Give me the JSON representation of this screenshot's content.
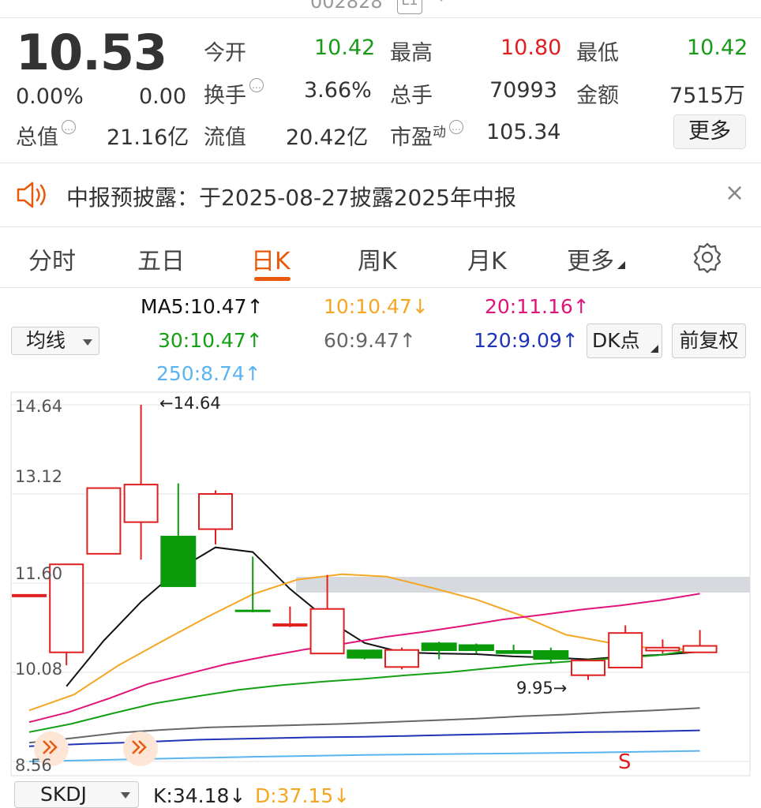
{
  "header": {
    "code": "002828",
    "market_tag": "L1"
  },
  "quote": {
    "price": "10.53",
    "change_pct": "0.00%",
    "change": "0.00",
    "open_label": "今开",
    "open": "10.42",
    "high_label": "最高",
    "high": "10.80",
    "low_label": "最低",
    "low": "10.42",
    "turnover_label": "换手",
    "turnover": "3.66%",
    "volume_label": "总手",
    "volume": "70993",
    "amount_label": "金额",
    "amount": "7515万",
    "mktcap_label": "总值",
    "mktcap": "21.16亿",
    "float_label": "流值",
    "float_cap": "20.42亿",
    "pe_label": "市盈",
    "pe_sup": "动",
    "pe": "105.34",
    "more_label": "更多"
  },
  "notice": {
    "text": "中报预披露：于2025-08-27披露2025年中报",
    "close_icon": "×"
  },
  "tabs": [
    {
      "label": "分时"
    },
    {
      "label": "五日"
    },
    {
      "label": "日K"
    },
    {
      "label": "周K"
    },
    {
      "label": "月K"
    },
    {
      "label": "更多"
    }
  ],
  "settings_icon": "gear-icon",
  "ma": {
    "ma5": "MA5:10.47↑",
    "ma10": "10:10.47↓",
    "ma20": "20:11.16↑",
    "ma30": "30:10.47↑",
    "ma60": "60:9.47↑",
    "ma120": "120:9.09↑",
    "ma250": "250:8.74↑"
  },
  "controls": {
    "avg_line": "均线",
    "dk_point": "DK点",
    "adjust": "前复权"
  },
  "colors": {
    "up": "#e02020",
    "down": "#0a9a0a",
    "ma5": "#111111",
    "ma10": "#f5a623",
    "ma20": "#e0147a",
    "ma30": "#13a013",
    "ma60": "#666666",
    "ma120": "#1f32b8",
    "ma250": "#5ab4f0",
    "accent": "#e8590c"
  },
  "chart_data": {
    "type": "candlestick",
    "y_ticks": [
      "14.64",
      "13.12",
      "11.60",
      "10.08",
      "8.56"
    ],
    "ylim": [
      8.56,
      14.64
    ],
    "max_label": "←14.64",
    "min_label": "9.95→",
    "candles": [
      {
        "o": 11.4,
        "c": 11.4,
        "h": 11.4,
        "l": 11.4
      },
      {
        "o": 10.42,
        "c": 11.92,
        "h": 11.92,
        "l": 10.2
      },
      {
        "o": 12.1,
        "c": 13.22,
        "h": 13.22,
        "l": 12.1
      },
      {
        "o": 12.64,
        "c": 13.28,
        "h": 14.64,
        "l": 12.0
      },
      {
        "o": 12.4,
        "c": 11.54,
        "h": 13.3,
        "l": 11.54
      },
      {
        "o": 12.52,
        "c": 13.12,
        "h": 13.18,
        "l": 12.26
      },
      {
        "o": 11.14,
        "c": 11.12,
        "h": 12.05,
        "l": 11.1
      },
      {
        "o": 10.88,
        "c": 10.9,
        "h": 11.2,
        "l": 10.85
      },
      {
        "o": 10.4,
        "c": 11.16,
        "h": 11.74,
        "l": 10.4
      },
      {
        "o": 10.46,
        "c": 10.32,
        "h": 10.46,
        "l": 10.3
      },
      {
        "o": 10.17,
        "c": 10.46,
        "h": 10.5,
        "l": 10.13
      },
      {
        "o": 10.58,
        "c": 10.45,
        "h": 10.6,
        "l": 10.3
      },
      {
        "o": 10.55,
        "c": 10.45,
        "h": 10.57,
        "l": 10.4
      },
      {
        "o": 10.45,
        "c": 10.4,
        "h": 10.55,
        "l": 10.4
      },
      {
        "o": 10.45,
        "c": 10.3,
        "h": 10.5,
        "l": 10.25
      },
      {
        "o": 10.03,
        "c": 10.28,
        "h": 10.28,
        "l": 9.95
      },
      {
        "o": 10.16,
        "c": 10.75,
        "h": 10.88,
        "l": 10.16
      },
      {
        "o": 10.45,
        "c": 10.5,
        "h": 10.64,
        "l": 10.4
      },
      {
        "o": 10.42,
        "c": 10.53,
        "h": 10.8,
        "l": 10.42
      }
    ],
    "series": [
      {
        "name": "MA5",
        "values": [
          null,
          9.84,
          10.62,
          11.28,
          11.83,
          12.21,
          12.13,
          11.5,
          10.98,
          10.58,
          10.42,
          10.4,
          10.39,
          10.35,
          10.33,
          10.3,
          10.35,
          10.38,
          10.43
        ]
      },
      {
        "name": "MA10",
        "values": [
          9.43,
          9.7,
          10.2,
          10.62,
          11.03,
          11.41,
          11.66,
          11.75,
          11.71,
          11.52,
          11.32,
          11.05,
          10.72,
          10.58,
          10.48,
          10.47
        ]
      },
      {
        "name": "MA20",
        "values": [
          9.23,
          9.4,
          9.63,
          9.88,
          10.05,
          10.22,
          10.35,
          10.47,
          10.57,
          10.68,
          10.77,
          10.87,
          10.98,
          11.06,
          11.15,
          11.22,
          11.31,
          11.42
        ]
      },
      {
        "name": "MA30",
        "values": [
          9.06,
          9.2,
          9.38,
          9.55,
          9.67,
          9.78,
          9.86,
          9.92,
          9.97,
          10.03,
          10.08,
          10.15,
          10.22,
          10.27,
          10.32,
          10.37,
          10.47
        ]
      },
      {
        "name": "MA60",
        "values": [
          8.88,
          8.96,
          9.05,
          9.1,
          9.14,
          9.16,
          9.18,
          9.2,
          9.23,
          9.26,
          9.29,
          9.33,
          9.36,
          9.4,
          9.43,
          9.47
        ]
      },
      {
        "name": "MA120",
        "values": [
          8.82,
          8.86,
          8.89,
          8.93,
          8.95,
          8.97,
          8.98,
          9.0,
          9.02,
          9.04,
          9.06,
          9.07,
          9.09
        ]
      },
      {
        "name": "MA250",
        "values": [
          8.56,
          8.6,
          8.64,
          8.67,
          8.69,
          8.71,
          8.74
        ]
      }
    ],
    "signal_label": "S"
  },
  "indicator": {
    "select": "SKDJ",
    "k": "K:34.18↓",
    "d": "D:37.15↓"
  }
}
